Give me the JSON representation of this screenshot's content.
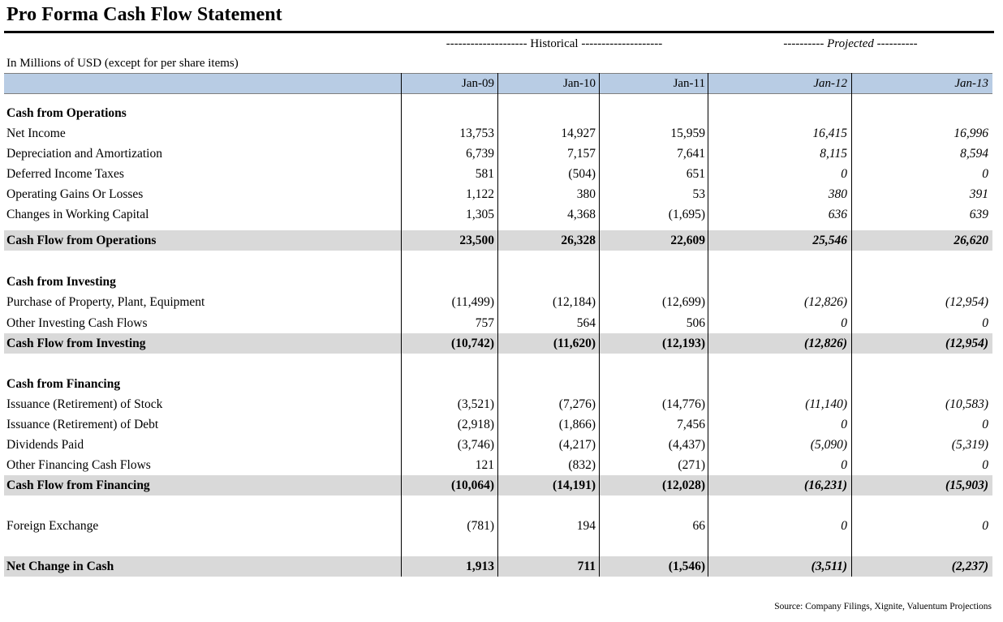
{
  "title": "Pro Forma Cash Flow Statement",
  "group_labels": {
    "historical": "-------------------- Historical --------------------",
    "projected": "---------- Projected ----------"
  },
  "units": "In Millions of USD (except for per share items)",
  "columns": [
    "Jan-09",
    "Jan-10",
    "Jan-11",
    "Jan-12",
    "Jan-13"
  ],
  "projected_columns": [
    3,
    4
  ],
  "rows": [
    {
      "type": "section",
      "label": "Cash from Operations",
      "values": []
    },
    {
      "type": "item",
      "label": "Net Income",
      "values": [
        "13,753",
        "14,927",
        "15,959",
        "16,415",
        "16,996"
      ]
    },
    {
      "type": "item",
      "label": "Depreciation and Amortization",
      "values": [
        "6,739",
        "7,157",
        "7,641",
        "8,115",
        "8,594"
      ]
    },
    {
      "type": "item",
      "label": "Deferred Income Taxes",
      "values": [
        "581",
        "(504)",
        "651",
        "0",
        "0"
      ]
    },
    {
      "type": "item",
      "label": "Operating Gains Or Losses",
      "values": [
        "1,122",
        "380",
        "53",
        "380",
        "391"
      ]
    },
    {
      "type": "item",
      "label": "Changes in Working Capital",
      "values": [
        "1,305",
        "4,368",
        "(1,695)",
        "636",
        "639"
      ]
    },
    {
      "type": "total",
      "label": "Cash Flow from Operations",
      "values": [
        "23,500",
        "26,328",
        "22,609",
        "25,546",
        "26,620"
      ]
    },
    {
      "type": "section",
      "label": "Cash from Investing",
      "values": []
    },
    {
      "type": "item",
      "label": "Purchase of Property, Plant, Equipment",
      "values": [
        "(11,499)",
        "(12,184)",
        "(12,699)",
        "(12,826)",
        "(12,954)"
      ]
    },
    {
      "type": "item",
      "label": "Other Investing Cash Flows",
      "values": [
        "757",
        "564",
        "506",
        "0",
        "0"
      ]
    },
    {
      "type": "total",
      "label": "Cash Flow from Investing",
      "values": [
        "(10,742)",
        "(11,620)",
        "(12,193)",
        "(12,826)",
        "(12,954)"
      ]
    },
    {
      "type": "section",
      "label": "Cash from Financing",
      "values": []
    },
    {
      "type": "item",
      "label": "Issuance (Retirement) of Stock",
      "values": [
        "(3,521)",
        "(7,276)",
        "(14,776)",
        "(11,140)",
        "(10,583)"
      ]
    },
    {
      "type": "item",
      "label": "Issuance (Retirement) of Debt",
      "values": [
        "(2,918)",
        "(1,866)",
        "7,456",
        "0",
        "0"
      ]
    },
    {
      "type": "item",
      "label": "Dividends Paid",
      "values": [
        "(3,746)",
        "(4,217)",
        "(4,437)",
        "(5,090)",
        "(5,319)"
      ]
    },
    {
      "type": "item",
      "label": "Other Financing Cash Flows",
      "values": [
        "121",
        "(832)",
        "(271)",
        "0",
        "0"
      ]
    },
    {
      "type": "total",
      "label": "Cash Flow from Financing",
      "values": [
        "(10,064)",
        "(14,191)",
        "(12,028)",
        "(16,231)",
        "(15,903)"
      ]
    },
    {
      "type": "item",
      "label": "Foreign Exchange",
      "values": [
        "(781)",
        "194",
        "66",
        "0",
        "0"
      ]
    },
    {
      "type": "total",
      "label": "Net Change in Cash",
      "values": [
        "1,913",
        "711",
        "(1,546)",
        "(3,511)",
        "(2,237)"
      ]
    }
  ],
  "source": "Source: Company Filings, Xignite, Valuentum Projections",
  "colors": {
    "header_fill": "#b8cce4",
    "total_fill": "#d9d9d9"
  }
}
